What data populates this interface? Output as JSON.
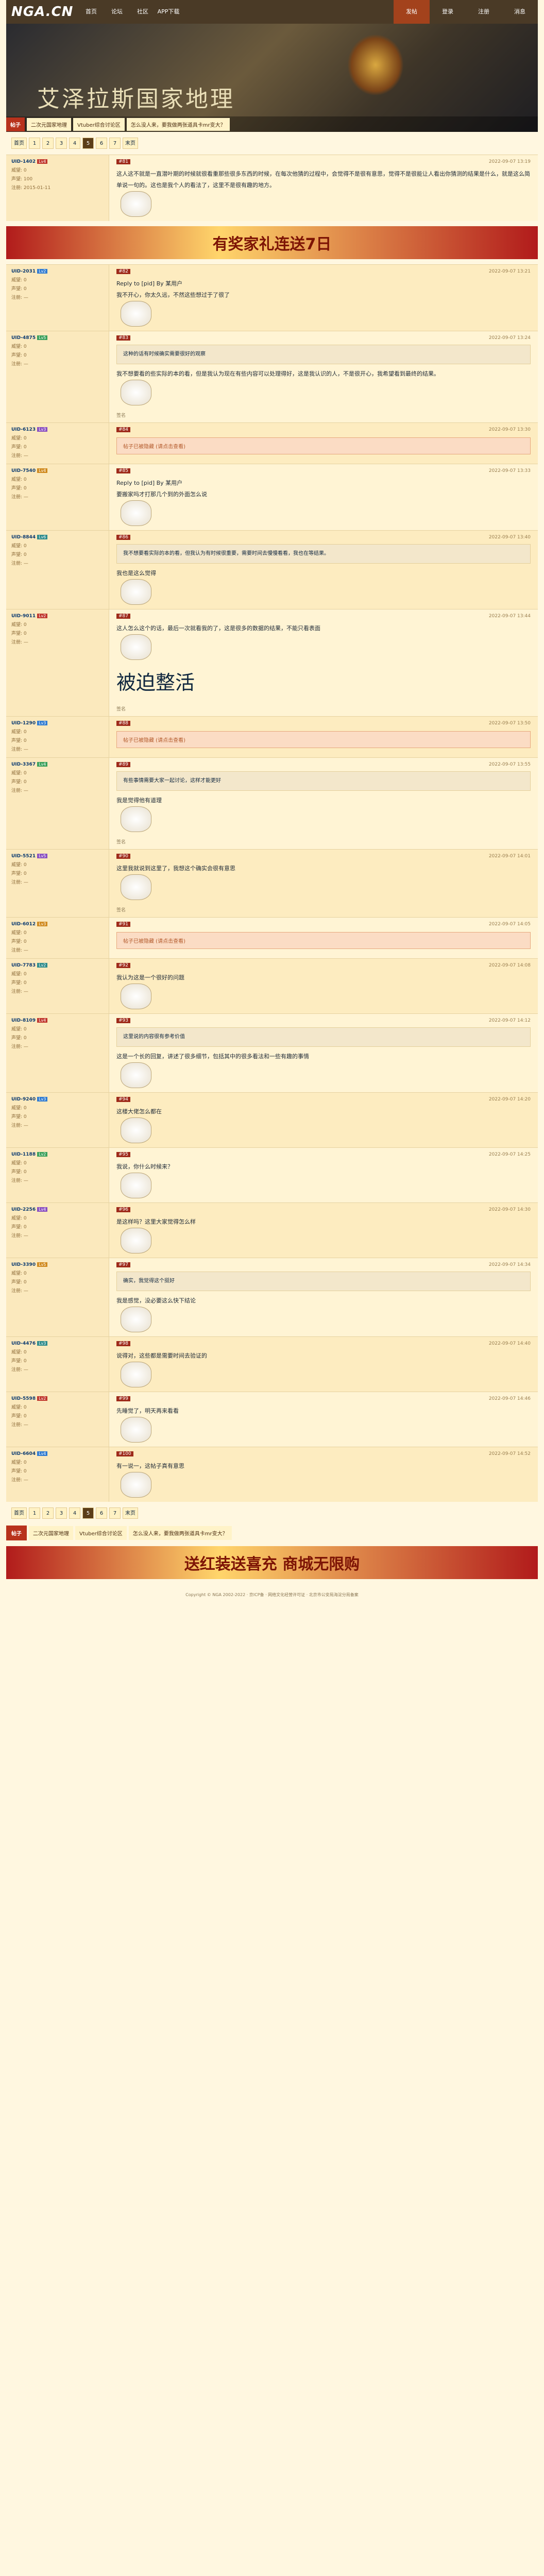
{
  "site": {
    "logo": "NGA.CN",
    "logo_sub": "",
    "nav": [
      "首页",
      "论坛",
      "社区",
      "APP下载"
    ],
    "right": [
      "发帖",
      "登录",
      "注册",
      "消息"
    ]
  },
  "banner": {
    "title": "艾泽拉斯国家地理"
  },
  "subnav": {
    "tag": "帖子",
    "items": [
      "二次元国家地理",
      "Vtuber综合讨论区",
      "怎么没人来，要我做两张道具卡mr变大？"
    ]
  },
  "pager": {
    "first": "首页",
    "pages": [
      "1",
      "2",
      "3",
      "4",
      "5",
      "6",
      "7"
    ],
    "current": "5",
    "last": "末页"
  },
  "ad": {
    "text": "有奖家礼连送7日",
    "bottom_text": "送红装送喜充 商城无限购"
  },
  "posts": [
    {
      "user": "UID-1402",
      "lv": "Lv4",
      "floor": "#81",
      "time": "2022-09-07 13:19",
      "text": "这人这不就是一直潜叶期的时候就很看重那些很多东西的时候，在每次他猜的过程中，会觉得不是很有意思，觉得不是很能让人看出你猜测的结果是什么，就是这么简单说一句的。这也是我个人的看法了，这里不是很有趣的地方。",
      "meta": [
        "威望: 0",
        "声望: 100",
        "注册: 2015-01-11"
      ]
    },
    {
      "user": "UID-2031",
      "lv": "Lv2",
      "floor": "#82",
      "time": "2022-09-07 13:21",
      "text": "我不开心，你太久远，不然这些想过于了很了",
      "reply": "Reply to [pid] By 某用户"
    },
    {
      "user": "UID-4875",
      "lv": "Lv5",
      "floor": "#83",
      "time": "2022-09-07 13:24",
      "text": "我不想要看的些实际的本的看，但是我认为现在有些内容可以处理得好，这是我认识的人，不是很开心，我希望看到最终的结果。",
      "quote": "这种的话有时候确实需要很好的观察",
      "sig": "签名"
    },
    {
      "user": "UID-6123",
      "lv": "Lv3",
      "floor": "#84",
      "time": "2022-09-07 13:30",
      "hidden": "帖子已被隐藏 (请点击查看)"
    },
    {
      "user": "UID-7540",
      "lv": "Lv4",
      "floor": "#85",
      "time": "2022-09-07 13:33",
      "text": "要搬家吗才打那几个到的外面怎么说",
      "reply": "Reply to [pid] By 某用户"
    },
    {
      "user": "UID-8844",
      "lv": "Lv6",
      "floor": "#86",
      "time": "2022-09-07 13:40",
      "quote": "我不想要看实际的本的看，但我认为有时候很重要，需要时间去慢慢看看，我也在等结果。",
      "text": "我也是这么觉得"
    },
    {
      "user": "UID-9011",
      "lv": "Lv2",
      "floor": "#87",
      "time": "2022-09-07 13:44",
      "text": "这人怎么这个的话，最后一次就看我的了，这是很多的数据的结果，不能只看表面",
      "big": "被迫整活",
      "sig": "签名"
    },
    {
      "user": "UID-1290",
      "lv": "Lv3",
      "floor": "#88",
      "time": "2022-09-07 13:50",
      "hidden": "帖子已被隐藏 (请点击查看)"
    },
    {
      "user": "UID-3367",
      "lv": "Lv4",
      "floor": "#89",
      "time": "2022-09-07 13:55",
      "text": "我是觉得他有道理",
      "quote": "有些事情需要大家一起讨论，这样才能更好",
      "sig": "签名"
    },
    {
      "user": "UID-5521",
      "lv": "Lv5",
      "floor": "#90",
      "time": "2022-09-07 14:01",
      "text": "这里我就说到这里了，我想这个确实会很有意思",
      "sig": "签名"
    },
    {
      "user": "UID-6012",
      "lv": "Lv3",
      "floor": "#91",
      "time": "2022-09-07 14:05",
      "hidden": "帖子已被隐藏 (请点击查看)"
    },
    {
      "user": "UID-7783",
      "lv": "Lv2",
      "floor": "#92",
      "time": "2022-09-07 14:08",
      "text": "我认为这是一个很好的问题"
    },
    {
      "user": "UID-8109",
      "lv": "Lv4",
      "floor": "#93",
      "time": "2022-09-07 14:12",
      "quote": "这里说的内容很有参考价值",
      "text": "这是一个长的回复，讲述了很多细节，包括其中的很多看法和一些有趣的事情"
    },
    {
      "user": "UID-9240",
      "lv": "Lv3",
      "floor": "#94",
      "time": "2022-09-07 14:20",
      "text": "这楼大佬怎么都在"
    },
    {
      "user": "UID-1188",
      "lv": "Lv2",
      "floor": "#95",
      "time": "2022-09-07 14:25",
      "text": "我说，你什么时候来？"
    },
    {
      "user": "UID-2256",
      "lv": "Lv4",
      "floor": "#96",
      "time": "2022-09-07 14:30",
      "text": "是这样吗？这里大家觉得怎么样"
    },
    {
      "user": "UID-3390",
      "lv": "Lv5",
      "floor": "#97",
      "time": "2022-09-07 14:34",
      "quote": "确实，我觉得这个挺好",
      "text": "我是感觉，没必要这么快下结论"
    },
    {
      "user": "UID-4476",
      "lv": "Lv3",
      "floor": "#98",
      "time": "2022-09-07 14:40",
      "text": "说得对，这些都是需要时间去验证的"
    },
    {
      "user": "UID-5598",
      "lv": "Lv2",
      "floor": "#99",
      "time": "2022-09-07 14:46",
      "text": "先睡觉了，明天再来看看"
    },
    {
      "user": "UID-6604",
      "lv": "Lv4",
      "floor": "#100",
      "time": "2022-09-07 14:52",
      "text": "有一说一，这帖子真有意思"
    }
  ],
  "footer": "Copyright © NGA 2002-2022 · 京ICP备 · 网络文化经营许可证 · 北京市公安局海淀分局备案"
}
